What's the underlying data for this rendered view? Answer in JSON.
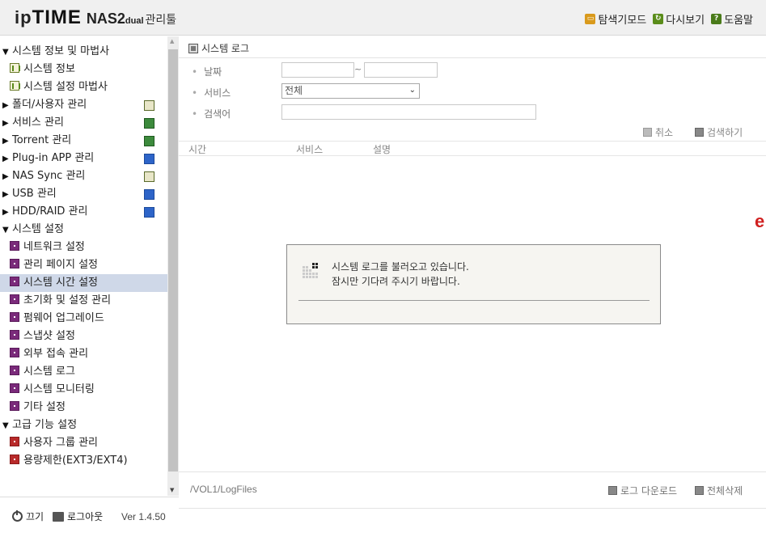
{
  "header": {
    "logo_ip": "ip",
    "logo_time": "TIME",
    "logo_model": "NAS2",
    "logo_dual": "dual",
    "logo_tool": "관리툴",
    "links": [
      {
        "label": "탐색기모드",
        "icon": "explorer-mode-icon"
      },
      {
        "label": "다시보기",
        "icon": "refresh-icon"
      },
      {
        "label": "도움말",
        "icon": "help-icon"
      }
    ]
  },
  "sidebar": {
    "items": [
      {
        "label": "시스템 정보 및 마법사",
        "type": "group",
        "expanded": true
      },
      {
        "label": "시스템 정보",
        "type": "sub",
        "icon": "chart-icon"
      },
      {
        "label": "시스템 설정 마법사",
        "type": "sub",
        "icon": "chart-icon"
      },
      {
        "label": "폴더/사용자 관리",
        "type": "group",
        "expanded": false,
        "icon": "folder-user-icon"
      },
      {
        "label": "서비스 관리",
        "type": "group",
        "expanded": false,
        "icon": "service-icon"
      },
      {
        "label": "Torrent 관리",
        "type": "group",
        "expanded": false,
        "icon": "torrent-icon"
      },
      {
        "label": "Plug-in APP 관리",
        "type": "group",
        "expanded": false,
        "icon": "plugin-icon"
      },
      {
        "label": "NAS Sync 관리",
        "type": "group",
        "expanded": false,
        "icon": "sync-icon"
      },
      {
        "label": "USB 관리",
        "type": "group",
        "expanded": false,
        "icon": "usb-icon"
      },
      {
        "label": "HDD/RAID 관리",
        "type": "group",
        "expanded": false,
        "icon": "hdd-icon"
      },
      {
        "label": "시스템 설정",
        "type": "group",
        "expanded": true
      },
      {
        "label": "네트워크 설정",
        "type": "sub",
        "icon": "settings-icon"
      },
      {
        "label": "관리 페이지 설정",
        "type": "sub",
        "icon": "settings-icon"
      },
      {
        "label": "시스템 시간 설정",
        "type": "sub",
        "icon": "settings-icon",
        "active": true
      },
      {
        "label": "초기화 및 설정 관리",
        "type": "sub",
        "icon": "settings-icon"
      },
      {
        "label": "펌웨어 업그레이드",
        "type": "sub",
        "icon": "settings-icon"
      },
      {
        "label": "스냅샷 설정",
        "type": "sub",
        "icon": "settings-icon"
      },
      {
        "label": "외부 접속 관리",
        "type": "sub",
        "icon": "settings-icon"
      },
      {
        "label": "시스템 로그",
        "type": "sub",
        "icon": "settings-icon"
      },
      {
        "label": "시스템 모니터링",
        "type": "sub",
        "icon": "settings-icon"
      },
      {
        "label": "기타 설정",
        "type": "sub",
        "icon": "settings-icon"
      },
      {
        "label": "고급 기능 설정",
        "type": "group",
        "expanded": true
      },
      {
        "label": "사용자 그룹 관리",
        "type": "sub",
        "icon": "advanced-icon"
      },
      {
        "label": "용량제한(EXT3/EXT4)",
        "type": "sub",
        "icon": "advanced-icon"
      }
    ],
    "footer": {
      "power_label": "끄기",
      "logout_label": "로그아웃",
      "version": "Ver 1.4.50"
    }
  },
  "main": {
    "title": "시스템 로그",
    "filters": {
      "date_label": "날짜",
      "date_from": "",
      "date_sep": "~",
      "date_to": "",
      "service_label": "서비스",
      "service_value": "전체",
      "keyword_label": "검색어",
      "keyword_value": ""
    },
    "actions": {
      "cancel_label": "취소",
      "search_label": "검색하기"
    },
    "columns": [
      "시간",
      "서비스",
      "설명"
    ],
    "dialog": {
      "line1": "시스템 로그를 불러오고 있습니다.",
      "line2": "잠시만 기다려 주시기 바랍니다."
    },
    "edge_letter": "e",
    "path": "/VOL1/LogFiles",
    "bottom": {
      "download_label": "로그 다운로드",
      "delete_all_label": "전체삭제"
    }
  },
  "colors": {
    "active_row": "#cfd8e8",
    "header_bg": "#f0f0f0",
    "settings_icon": "#7a2a7a",
    "advanced_icon": "#b82a2a"
  }
}
